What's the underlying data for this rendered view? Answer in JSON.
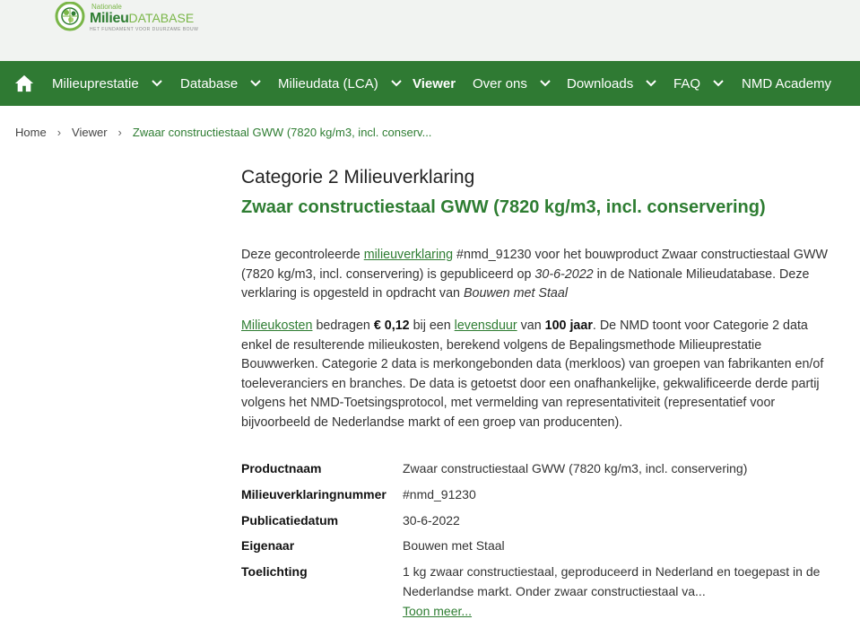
{
  "logo": {
    "small": "Nationale",
    "main": "Milieu",
    "main_suffix": "DATABASE",
    "tagline": "HET FUNDAMENT VOOR DUURZAME BOUW"
  },
  "nav": {
    "items": [
      {
        "label": "Milieuprestatie"
      },
      {
        "label": "Database"
      },
      {
        "label": "Milieudata (LCA)"
      },
      {
        "label": "Viewer"
      },
      {
        "label": "Over ons"
      },
      {
        "label": "Downloads"
      },
      {
        "label": "FAQ"
      },
      {
        "label": "NMD Academy"
      }
    ]
  },
  "breadcrumb": {
    "home": "Home",
    "viewer": "Viewer",
    "current": "Zwaar constructiestaal GWW (7820 kg/m3, incl. conserv..."
  },
  "main": {
    "category": "Categorie 2 Milieuverklaring",
    "title": "Zwaar constructiestaal GWW (7820 kg/m3, incl. conservering)",
    "p1": {
      "t1": "Deze gecontroleerde ",
      "link1": "milieuverklaring",
      "t2": " #nmd_91230 voor het bouwproduct Zwaar constructiestaal GWW (7820 kg/m3, incl. conservering) is gepubliceerd op ",
      "date": "30-6-2022",
      "t3": " in de Nationale Milieudatabase. Deze verklaring is opgesteld in opdracht van ",
      "owner": "Bouwen met Staal"
    },
    "p2": {
      "link1": "Milieukosten",
      "t1": " bedragen ",
      "cost": "€ 0,12",
      "t2": " bij een ",
      "link2": "levensduur",
      "t3": " van ",
      "life": "100 jaar",
      "t4": ". De NMD toont voor Categorie 2 data enkel de resulterende milieukosten, berekend volgens de Bepalingsmethode Milieuprestatie Bouwwerken. Categorie 2 data is merkongebonden data (merkloos) van groepen van fabrikanten en/of toeleveranciers en branches. De data is getoetst door een onafhankelijke, gekwalificeerde derde partij volgens het NMD-Toetsingsprotocol, met vermelding van representativiteit (representatief voor bijvoorbeeld de Nederlandse markt of een groep van producenten)."
    }
  },
  "details": [
    {
      "key": "Productnaam",
      "value": "Zwaar constructiestaal GWW (7820 kg/m3, incl. conservering)"
    },
    {
      "key": "Milieuverklaringnummer",
      "value": "#nmd_91230"
    },
    {
      "key": "Publicatiedatum",
      "value": "30-6-2022"
    },
    {
      "key": "Eigenaar",
      "value": "Bouwen met Staal"
    },
    {
      "key": "Toelichting",
      "value": "1 kg zwaar constructiestaal, geproduceerd in Nederland en toegepast in de Nederlandse markt. Onder zwaar constructiestaal va..."
    }
  ],
  "more_link": "Toon meer...",
  "colors": {
    "brand_green": "#2f7a33",
    "link_green": "#2e7d32",
    "header_bg": "#f1f3f1"
  },
  "icons": {
    "home": "home-icon",
    "chevron": "chevron-down-icon",
    "breadcrumb_sep": "chevron-right-icon",
    "logo": "globe-logo-icon"
  }
}
